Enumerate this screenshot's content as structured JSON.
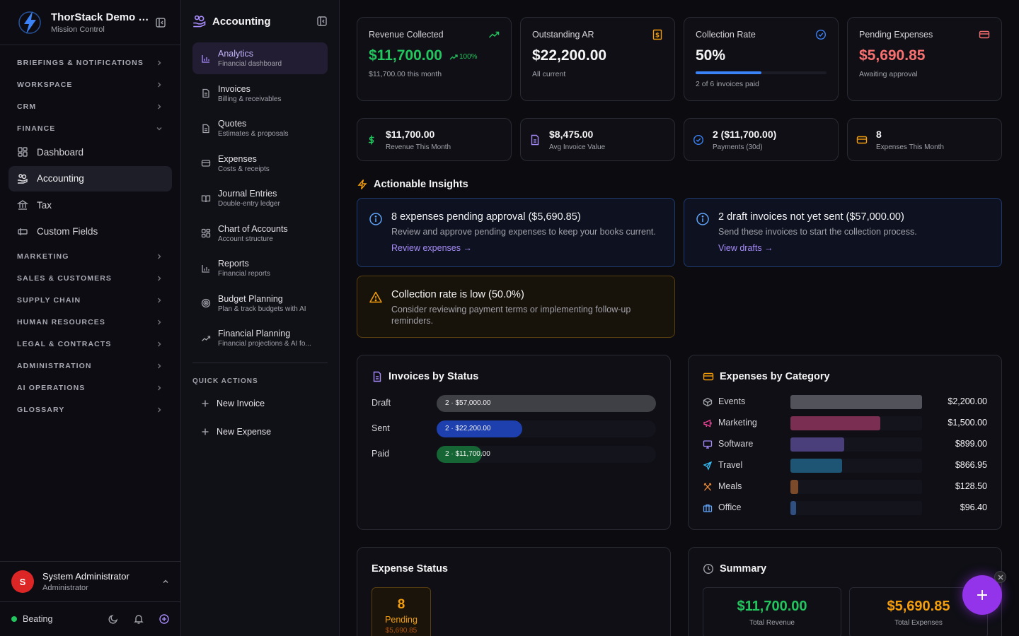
{
  "brand": {
    "name": "ThorStack Demo C...",
    "subtitle": "Mission Control"
  },
  "sidebar": {
    "groups_top": [
      "BRIEFINGS & NOTIFICATIONS",
      "WORKSPACE",
      "CRM"
    ],
    "finance_label": "FINANCE",
    "finance_items": [
      "Dashboard",
      "Accounting",
      "Tax",
      "Custom Fields"
    ],
    "groups_bottom": [
      "MARKETING",
      "SALES & CUSTOMERS",
      "SUPPLY CHAIN",
      "HUMAN RESOURCES",
      "LEGAL & CONTRACTS",
      "ADMINISTRATION",
      "AI OPERATIONS",
      "GLOSSARY"
    ]
  },
  "user": {
    "initial": "S",
    "name": "System Administrator",
    "role": "Administrator"
  },
  "footer": {
    "status": "Beating",
    "status_color": "#22c55e"
  },
  "subnav": {
    "title": "Accounting",
    "items": [
      {
        "label": "Analytics",
        "desc": "Financial dashboard"
      },
      {
        "label": "Invoices",
        "desc": "Billing & receivables"
      },
      {
        "label": "Quotes",
        "desc": "Estimates & proposals"
      },
      {
        "label": "Expenses",
        "desc": "Costs & receipts"
      },
      {
        "label": "Journal Entries",
        "desc": "Double-entry ledger"
      },
      {
        "label": "Chart of Accounts",
        "desc": "Account structure"
      },
      {
        "label": "Reports",
        "desc": "Financial reports"
      },
      {
        "label": "Budget Planning",
        "desc": "Plan & track budgets with AI"
      },
      {
        "label": "Financial Planning",
        "desc": "Financial projections & AI fo..."
      }
    ],
    "quick_actions_label": "QUICK ACTIONS",
    "quick_actions": [
      "New Invoice",
      "New Expense"
    ]
  },
  "kpis": [
    {
      "label": "Revenue Collected",
      "value": "$11,700.00",
      "trend": "100%",
      "sub": "$11,700.00 this month",
      "color": "#22c55e"
    },
    {
      "label": "Outstanding AR",
      "value": "$22,200.00",
      "sub": "All current",
      "color": "#f4f4f5"
    },
    {
      "label": "Collection Rate",
      "value": "50%",
      "progress": 0.5,
      "sub": "2 of 6 invoices paid",
      "color": "#f4f4f5"
    },
    {
      "label": "Pending Expenses",
      "value": "$5,690.85",
      "sub": "Awaiting approval",
      "color": "#f87171"
    }
  ],
  "mini": [
    {
      "value": "$11,700.00",
      "label": "Revenue This Month"
    },
    {
      "value": "$8,475.00",
      "label": "Avg Invoice Value"
    },
    {
      "value": "2 ($11,700.00)",
      "label": "Payments (30d)"
    },
    {
      "value": "8",
      "label": "Expenses This Month"
    }
  ],
  "insights": {
    "title": "Actionable Insights",
    "items": [
      {
        "title": "8 expenses pending approval ($5,690.85)",
        "desc": "Review and approve pending expenses to keep your books current.",
        "action": "Review expenses →"
      },
      {
        "title": "2 draft invoices not yet sent ($57,000.00)",
        "desc": "Send these invoices to start the collection process.",
        "action": "View drafts →"
      },
      {
        "title": "Collection rate is low (50.0%)",
        "desc": "Consider reviewing payment terms or implementing follow-up reminders."
      }
    ]
  },
  "invoices_status": {
    "title": "Invoices by Status",
    "rows": [
      {
        "label": "Draft",
        "text": "2 · $57,000.00",
        "value": 57000,
        "color": "#3f3f46"
      },
      {
        "label": "Sent",
        "text": "2 · $22,200.00",
        "value": 22200,
        "color": "#1e40af"
      },
      {
        "label": "Paid",
        "text": "2 · $11,700.00",
        "value": 11700,
        "color": "#166534"
      }
    ]
  },
  "expenses_category": {
    "title": "Expenses by Category",
    "rows": [
      {
        "label": "Events",
        "amount": "$2,200.00",
        "value": 2200,
        "color": "#52525b",
        "icon": "cube-icon",
        "icon_color": "#a1a1aa"
      },
      {
        "label": "Marketing",
        "amount": "$1,500.00",
        "value": 1500,
        "color": "#7a2f52",
        "icon": "megaphone-icon",
        "icon_color": "#ec4899"
      },
      {
        "label": "Software",
        "amount": "$899.00",
        "value": 899,
        "color": "#4a3f7a",
        "icon": "monitor-icon",
        "icon_color": "#a78bfa"
      },
      {
        "label": "Travel",
        "amount": "$866.95",
        "value": 866.95,
        "color": "#1e5575",
        "icon": "plane-icon",
        "icon_color": "#38bdf8"
      },
      {
        "label": "Meals",
        "amount": "$128.50",
        "value": 128.5,
        "color": "#7a4a2a",
        "icon": "utensils-icon",
        "icon_color": "#fb923c"
      },
      {
        "label": "Office",
        "amount": "$96.40",
        "value": 96.4,
        "color": "#2e4f80",
        "icon": "briefcase-icon",
        "icon_color": "#60a5fa"
      }
    ]
  },
  "expense_status": {
    "title": "Expense Status",
    "count": "8",
    "label": "Pending",
    "amount": "$5,690.85"
  },
  "summary": {
    "title": "Summary",
    "revenue": "$11,700.00",
    "revenue_label": "Total Revenue",
    "expenses": "$5,690.85",
    "expenses_label": "Total Expenses"
  }
}
